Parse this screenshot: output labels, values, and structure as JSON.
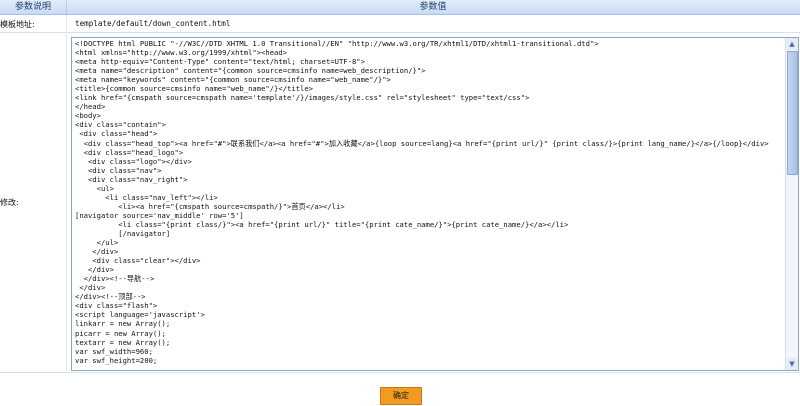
{
  "table": {
    "header_label": "参数说明",
    "header_value": "参数值"
  },
  "template_path": {
    "label": "模板地址:",
    "value": "template/default/down_content.html"
  },
  "editor": {
    "label": "修改:",
    "lines": [
      "<!DOCTYPE html PUBLIC \"-//W3C//DTD XHTML 1.0 Transitional//EN\" \"http://www.w3.org/TR/xhtml1/DTD/xhtml1-transitional.dtd\">",
      "<html xmlns=\"http://www.w3.org/1999/xhtml\"><head>",
      "<meta http-equiv=\"Content-Type\" content=\"text/html; charset=UTF-8\">",
      "<meta name=\"description\" content=\"{common source=cmsinfo name=web_description/}\">",
      "<meta name=\"keywords\" content=\"{common source=cmsinfo name=\"web_name\"/}\">",
      "<title>{common source=cmsinfo name=\"web_name\"/}</title>",
      "<link href=\"{cmspath source=cmspath name='template'/}/images/style.css\" rel=\"stylesheet\" type=\"text/css\">",
      "</head>",
      "<body>",
      "<div class=\"contain\">",
      " <div class=\"head\">",
      "  <div class=\"head_top\"><a href=\"#\">联系我们</a><a href=\"#\">加入收藏</a>{loop source=lang}<a href=\"{print url/}\" {print class/}>{print lang_name/}</a>{/loop}</div>",
      "  <div class=\"head_logo\">",
      "   <div class=\"logo\"></div>",
      "   <div class=\"nav\">",
      "   <div class=\"nav_right\">",
      "     <ul>",
      "       <li class=\"nav_left\"></li>",
      "          <li><a href=\"{cmspath source=cmspath/}\">首页</a></li>",
      "[navigator source='nav_middle' row='5']",
      "          <li class=\"{print class/}\"><a href=\"{print url/}\" title=\"{print cate_name/}\">{print cate_name/}</a></li>",
      "          [/navigator]",
      "     </ul>",
      "    </div>",
      "    <div class=\"clear\"></div>",
      "   </div>",
      "  </div><!--导航-->",
      " </div>",
      "</div><!--顶部-->",
      "<div class=\"flash\">",
      "<script language='javascript'>",
      "linkarr = new Array();",
      "picarr = new Array();",
      "textarr = new Array();",
      "var swf_width=960;",
      "var swf_height=200;"
    ]
  },
  "scrollbar": {
    "up_icon": "▲",
    "down_icon": "▼"
  },
  "submit": {
    "label": "确定"
  },
  "colors": {
    "header_bg": "#c9daf3",
    "button_bg": "#f39a20",
    "border": "#8fa6c3"
  }
}
